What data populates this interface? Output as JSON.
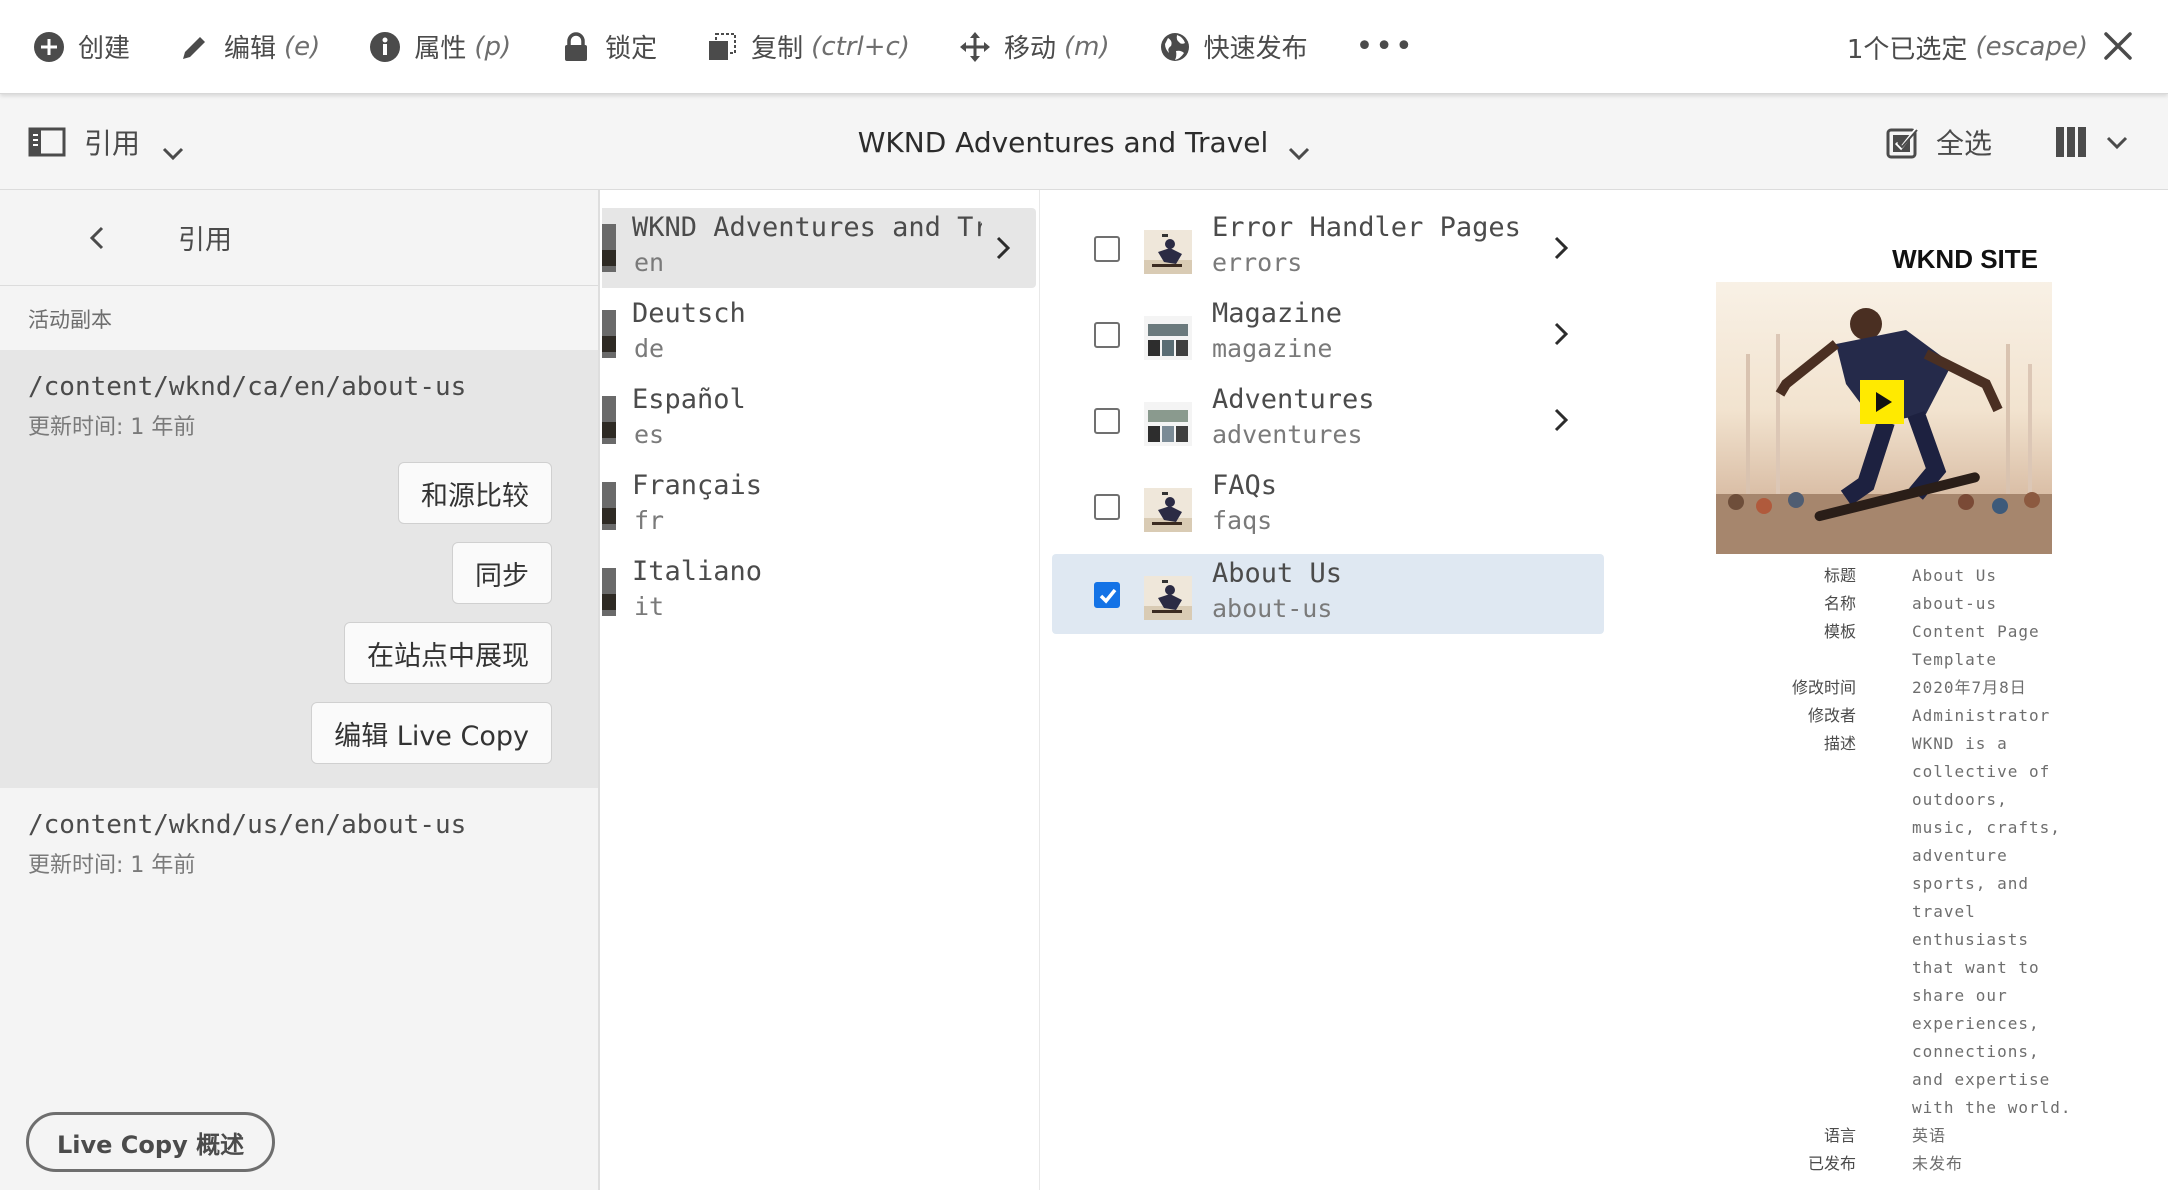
{
  "actionbar": {
    "create": "创建",
    "edit": "编辑",
    "edit_hint": "(e)",
    "properties": "属性",
    "properties_hint": "(p)",
    "lock": "锁定",
    "copy": "复制",
    "copy_hint": "(ctrl+c)",
    "move": "移动",
    "move_hint": "(m)",
    "quick_publish": "快速发布",
    "more": "•••",
    "selection_count": "1个已选定",
    "selection_hint": "(escape)"
  },
  "titlebar": {
    "rail_label": "引用",
    "title": "WKND Adventures and Travel",
    "select_all": "全选"
  },
  "rail": {
    "header": "引用",
    "section_label": "活动副本",
    "items": [
      {
        "path": "/content/wknd/ca/en/about-us",
        "time": "更新时间: 1 年前"
      },
      {
        "path": "/content/wknd/us/en/about-us",
        "time": "更新时间: 1 年前"
      }
    ],
    "actions": [
      "和源比较",
      "同步",
      "在站点中展现",
      "编辑 Live Copy"
    ],
    "overview_button": "Live Copy 概述"
  },
  "column1": [
    {
      "title": "WKND Adventures and Tra…",
      "name": "en",
      "selected": true,
      "has_children": true
    },
    {
      "title": "Deutsch",
      "name": "de",
      "selected": false,
      "has_children": false
    },
    {
      "title": "Español",
      "name": "es",
      "selected": false,
      "has_children": false
    },
    {
      "title": "Français",
      "name": "fr",
      "selected": false,
      "has_children": false
    },
    {
      "title": "Italiano",
      "name": "it",
      "selected": false,
      "has_children": false
    }
  ],
  "column2": [
    {
      "title": "Error Handler Pages",
      "name": "errors",
      "checked": false,
      "has_children": true
    },
    {
      "title": "Magazine",
      "name": "magazine",
      "checked": false,
      "has_children": true
    },
    {
      "title": "Adventures",
      "name": "adventures",
      "checked": false,
      "has_children": true
    },
    {
      "title": "FAQs",
      "name": "faqs",
      "checked": false,
      "has_children": false
    },
    {
      "title": "About Us",
      "name": "about-us",
      "checked": true,
      "has_children": false
    }
  ],
  "preview": {
    "brand": "WKND SITE",
    "meta": [
      {
        "label": "标题",
        "value": "About Us"
      },
      {
        "label": "名称",
        "value": "about-us"
      },
      {
        "label": "模板",
        "value": "Content Page Template"
      },
      {
        "label": "修改时间",
        "value": "2020年7月8日"
      },
      {
        "label": "修改者",
        "value": "Administrator"
      },
      {
        "label": "描述",
        "value": "WKND is a collective of outdoors, music, crafts, adventure sports, and travel enthusiasts that want to share our experiences, connections, and expertise with the world."
      },
      {
        "label": "语言",
        "value": "英语"
      },
      {
        "label": "已发布",
        "value": "未发布"
      }
    ]
  },
  "colors": {
    "accent": "#1473e6",
    "selected_row": "#dfe8f2",
    "rail_bg": "#f4f4f4"
  }
}
